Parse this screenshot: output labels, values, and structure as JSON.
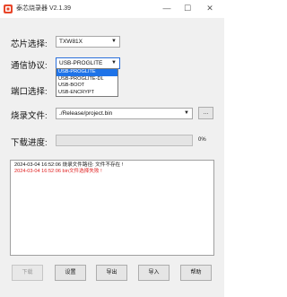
{
  "window": {
    "title": "泰芯烧录器 V2.1.39",
    "minimize_glyph": "—",
    "maximize_glyph": "☐",
    "close_glyph": "✕"
  },
  "form": {
    "chip_label": "芯片选择:",
    "chip_value": "TXW81X",
    "protocol_label": "通信协议:",
    "protocol_value": "USB-PROGLITE",
    "protocol_options": [
      "USB-PROGLITE",
      "USB-PROGLITE-DL",
      "USB-BOOT",
      "USB-ENCRYPT"
    ],
    "port_label": "端口选择:",
    "file_label": "烧录文件:",
    "file_value": "./Release/project.bin",
    "browse_label": "...",
    "progress_label": "下载进度:",
    "progress_percent": "0%",
    "progress_value": 0
  },
  "log": {
    "lines": [
      {
        "text": "2024-03-04 16:52:06 烧录文件路径: 文件不存在 !",
        "color": "#111111"
      },
      {
        "text": "2024-03-04 16:52:06 bin文件选择失败 !",
        "color": "#e02020"
      }
    ]
  },
  "buttons": {
    "download": "下载",
    "settings": "设置",
    "export": "导出",
    "import": "导入",
    "help": "帮助"
  },
  "colors": {
    "selection": "#1e73e8",
    "error": "#e02020",
    "progress_fill": "#06b025"
  },
  "icons": {
    "app": "app-logo-icon",
    "dropdown_arrow": "chevron-down-icon"
  }
}
